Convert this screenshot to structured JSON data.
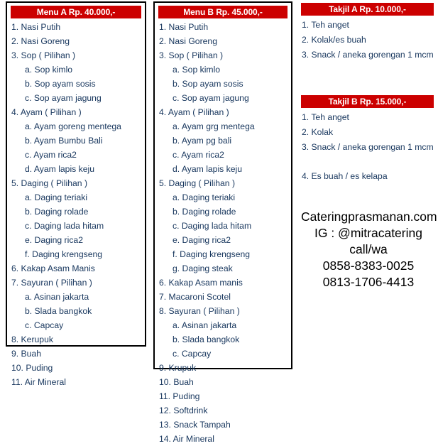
{
  "colors": {
    "header_red": "#cc0000",
    "list_text": "#17365d",
    "border": "#000000",
    "contact_text": "#000000"
  },
  "menu_a": {
    "header": "Menu A Rp. 40.000,-",
    "items": [
      {
        "text": "1. Nasi Putih",
        "level": 1
      },
      {
        "text": "2. Nasi Goreng",
        "level": 1
      },
      {
        "text": "3. Sop ( Pilihan )",
        "level": 1
      },
      {
        "text": "a. Sop kimlo",
        "level": 2
      },
      {
        "text": "b. Sop ayam sosis",
        "level": 2
      },
      {
        "text": "c. Sop ayam jagung",
        "level": 2
      },
      {
        "text": "4. Ayam ( Pilihan )",
        "level": 1
      },
      {
        "text": "a. Ayam goreng mentega",
        "level": 2
      },
      {
        "text": "b. Ayam Bumbu Bali",
        "level": 2
      },
      {
        "text": "c. Ayam rica2",
        "level": 2
      },
      {
        "text": "d. Ayam lapis keju",
        "level": 2
      },
      {
        "text": "5. Daging ( Pilihan )",
        "level": 1
      },
      {
        "text": "a. Daging teriaki",
        "level": 2
      },
      {
        "text": "b. Daging rolade",
        "level": 2
      },
      {
        "text": "c. Daging lada hitam",
        "level": 2
      },
      {
        "text": "e. Daging rica2",
        "level": 2
      },
      {
        "text": "f. Daging krengseng",
        "level": 2
      },
      {
        "text": "6. Kakap Asam Manis",
        "level": 1
      },
      {
        "text": "7. Sayuran ( Pilihan )",
        "level": 1
      },
      {
        "text": "a. Asinan jakarta",
        "level": 2
      },
      {
        "text": "b. Slada bangkok",
        "level": 2
      },
      {
        "text": "c. Capcay",
        "level": 2
      },
      {
        "text": "8. Kerupuk",
        "level": 1
      },
      {
        "text": "9. Buah",
        "level": 1
      },
      {
        "text": "10. Puding",
        "level": 1
      },
      {
        "text": "11. Air Mineral",
        "level": 1
      }
    ]
  },
  "menu_b": {
    "header": "Menu B Rp. 45.000,-",
    "items": [
      {
        "text": "1. Nasi Putih",
        "level": 1
      },
      {
        "text": "2. Nasi Goreng",
        "level": 1
      },
      {
        "text": "3. Sop ( Pilihan )",
        "level": 1
      },
      {
        "text": "a. Sop kimlo",
        "level": 2
      },
      {
        "text": "b. Sop ayam sosis",
        "level": 2
      },
      {
        "text": "c. Sop ayam jagung",
        "level": 2
      },
      {
        "text": "4. Ayam ( Pilihan )",
        "level": 1
      },
      {
        "text": "a. Ayam grg mentega",
        "level": 2
      },
      {
        "text": "b. Ayam pg bali",
        "level": 2
      },
      {
        "text": "c. Ayam rica2",
        "level": 2
      },
      {
        "text": "d. Ayam lapis keju",
        "level": 2
      },
      {
        "text": "5. Daging ( Pilihan )",
        "level": 1
      },
      {
        "text": "a. Daging teriaki",
        "level": 2
      },
      {
        "text": "b. Daging rolade",
        "level": 2
      },
      {
        "text": "c. Daging lada hitam",
        "level": 2
      },
      {
        "text": "e. Daging rica2",
        "level": 2
      },
      {
        "text": "f. Daging krengseng",
        "level": 2
      },
      {
        "text": "g. Daging steak",
        "level": 2
      },
      {
        "text": "6. Kakap Asam manis",
        "level": 1
      },
      {
        "text": "7. Macaroni Scotel",
        "level": 1
      },
      {
        "text": "8. Sayuran ( Pilihan )",
        "level": 1
      },
      {
        "text": "a. Asinan jakarta",
        "level": 2
      },
      {
        "text": "b. Slada bangkok",
        "level": 2
      },
      {
        "text": "c. Capcay",
        "level": 2
      },
      {
        "text": "9. Krupuk",
        "level": 1
      },
      {
        "text": "10. Buah",
        "level": 1
      },
      {
        "text": "11. Puding",
        "level": 1
      },
      {
        "text": "12. Softdrink",
        "level": 1
      },
      {
        "text": "13. Snack Tampah",
        "level": 1
      },
      {
        "text": "14. Air Mineral",
        "level": 1
      }
    ]
  },
  "takjil_a": {
    "header": "Takjil A Rp. 10.000,-",
    "items": [
      {
        "text": "1. Teh anget",
        "level": 1
      },
      {
        "text": "2. Kolak/es buah",
        "level": 1
      },
      {
        "text": "3. Snack / aneka gorengan 1 mcm",
        "level": 1
      }
    ]
  },
  "takjil_b": {
    "header": "Takjil B Rp. 15.000,-",
    "items": [
      {
        "text": "1. Teh anget",
        "level": 1
      },
      {
        "text": "2. Kolak",
        "level": 1
      },
      {
        "text": "3. Snack / aneka gorengan 1 mcm",
        "level": 1
      },
      {
        "text": "",
        "level": 1,
        "spacer": true
      },
      {
        "text": "4. Es buah / es kelapa",
        "level": 1
      }
    ]
  },
  "contact": {
    "lines": [
      "Cateringprasmanan.com",
      "IG : @mitracatering",
      "call/wa",
      "0858-8383-0025",
      "0813-1706-4413"
    ]
  }
}
